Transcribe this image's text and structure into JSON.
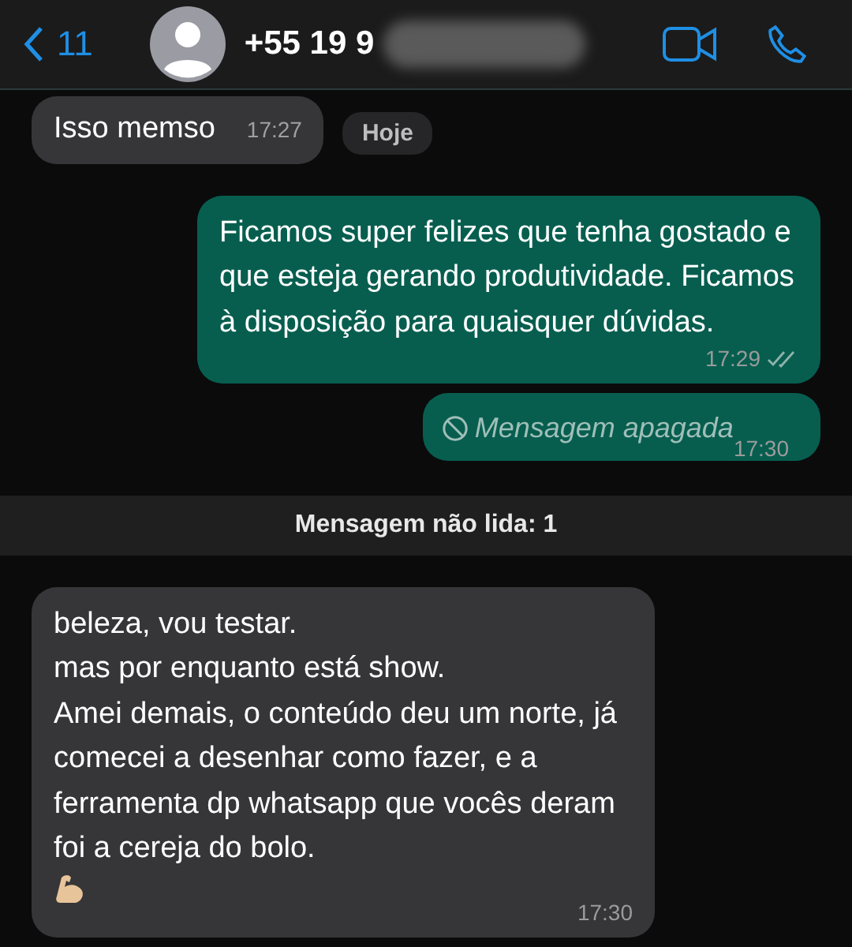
{
  "header": {
    "back_count": "11",
    "contact": "+55 19 9"
  },
  "messages": [
    {
      "kind": "incoming",
      "lines": [
        "Isso memso"
      ],
      "time": "17:27"
    },
    {
      "kind": "date",
      "text": "Hoje"
    },
    {
      "kind": "outgoing",
      "lines": [
        "Ficamos super felizes que tenha gostado e que esteja gerando produtividade. Ficamos à disposição para quaisquer dúvidas."
      ],
      "time": "17:29",
      "read": false
    },
    {
      "kind": "deleted",
      "text": "Mensagem apagada",
      "time": "17:30"
    },
    {
      "kind": "unread",
      "text": "Mensagem não lida: 1"
    },
    {
      "kind": "incoming",
      "lines": [
        "beleza, vou testar.",
        "mas por enquanto está show.",
        "Amei demais, o conteúdo deu um norte, já comecei a desenhar como fazer, e a ferramenta dp whatsapp que vocês deram foi a cereja do bolo."
      ],
      "emoji": true,
      "time": "17:30"
    }
  ]
}
